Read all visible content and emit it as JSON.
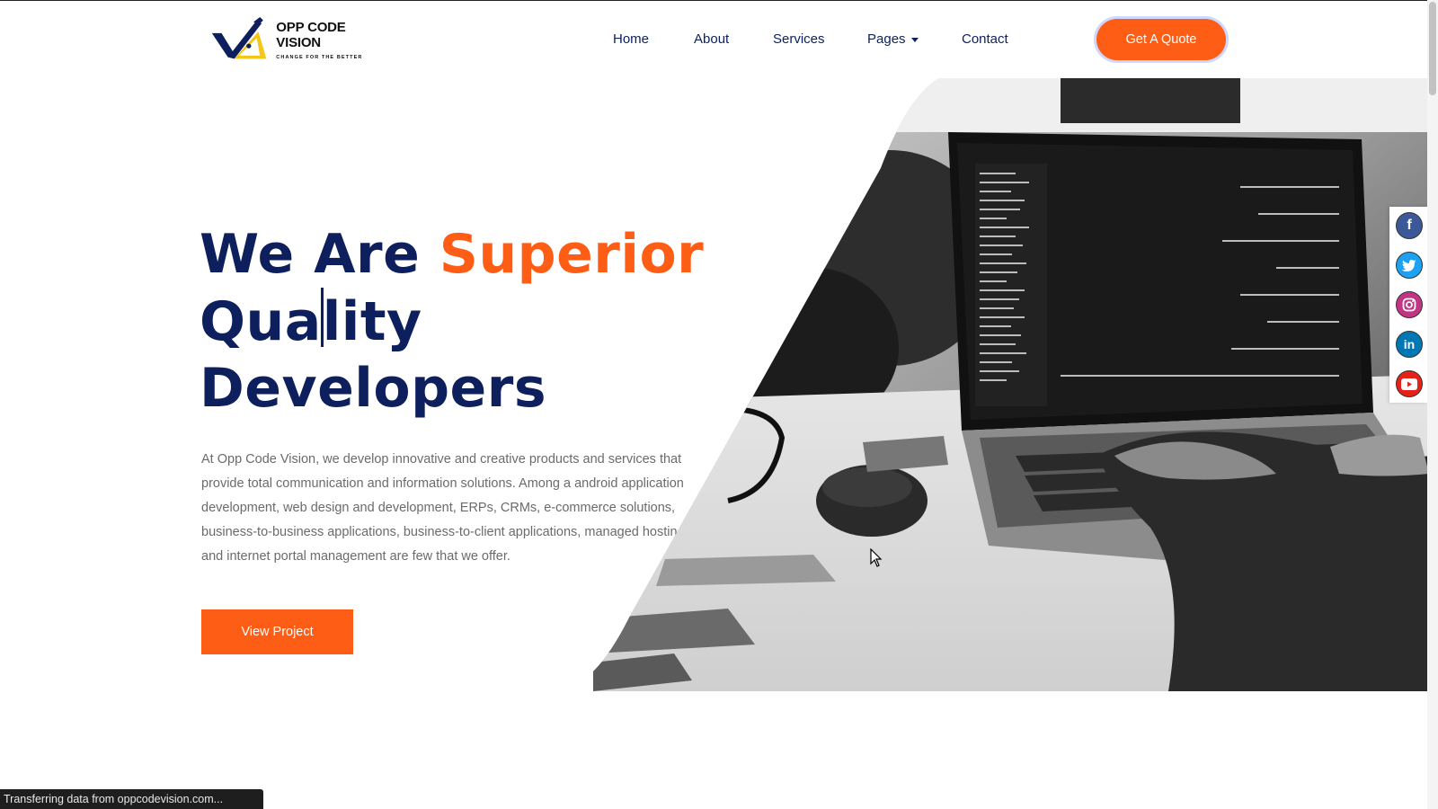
{
  "logo": {
    "title": "OPP CODE VISION",
    "tagline": "CHANGE FOR THE BETTER"
  },
  "nav": {
    "items": [
      {
        "label": "Home"
      },
      {
        "label": "About"
      },
      {
        "label": "Services"
      },
      {
        "label": "Pages"
      },
      {
        "label": "Contact"
      }
    ],
    "cta_label": "Get A Quote"
  },
  "hero": {
    "title_part1": "We Are ",
    "title_accent": "Superior",
    "title_line2_a": "Qua",
    "title_line2_b": "lity",
    "title_line3": "Developers",
    "description": "At Opp Code Vision, we develop innovative and creative products and services that provide total communication and information solutions. Among a android application development, web design and development, ERPs, CRMs, e-commerce solutions, business-to-business applications, business-to-client applications, managed hosting and internet portal management are few that we offer.",
    "button_label": "View Project"
  },
  "social": {
    "icons": [
      "facebook-icon",
      "twitter-icon",
      "instagram-icon",
      "linkedin-icon",
      "youtube-icon"
    ]
  },
  "status_bar": {
    "text": "Transferring data from oppcodevision.com..."
  },
  "colors": {
    "accent": "#fd5d14",
    "navy": "#0d1f5c",
    "text_gray": "#6b6b6b"
  }
}
